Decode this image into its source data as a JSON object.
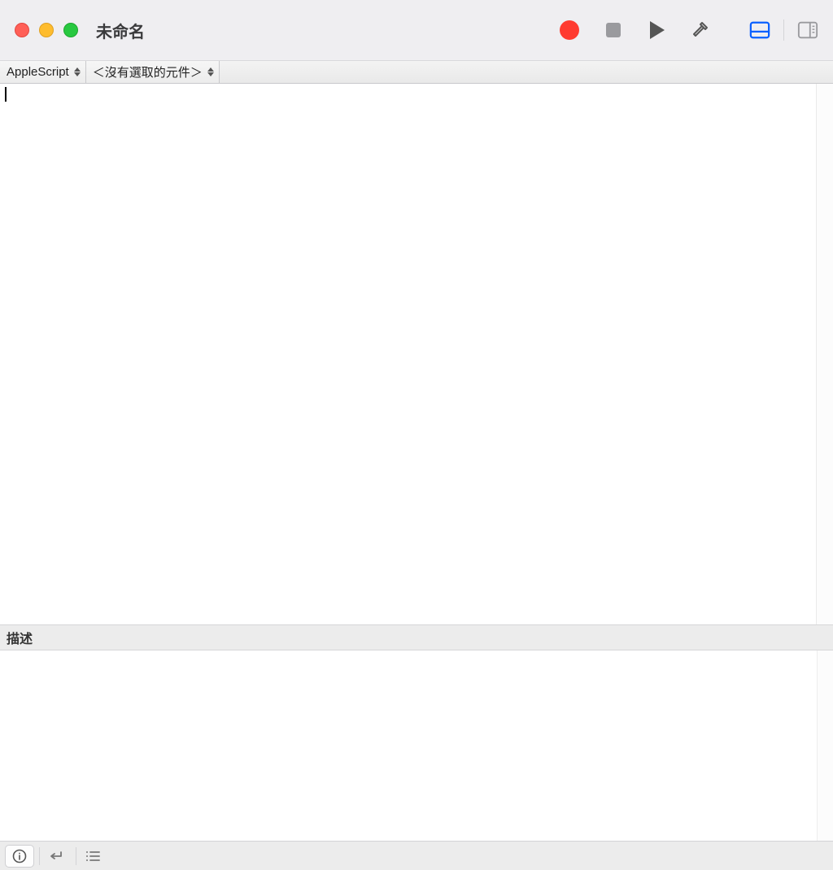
{
  "window": {
    "title": "未命名"
  },
  "navbar": {
    "language": "AppleScript",
    "selection": "＜沒有選取的元件＞"
  },
  "editor": {
    "content": ""
  },
  "description": {
    "header": "描述",
    "content": ""
  },
  "icons": {
    "record": "record-icon",
    "stop": "stop-icon",
    "play": "play-icon",
    "build": "hammer-icon",
    "view_log": "tray-icon",
    "sidebar": "sidebar-icon",
    "info": "info-icon",
    "return": "return-icon",
    "list": "list-icon"
  },
  "colors": {
    "accent": "#0a60ff",
    "record": "#ff3b30"
  }
}
